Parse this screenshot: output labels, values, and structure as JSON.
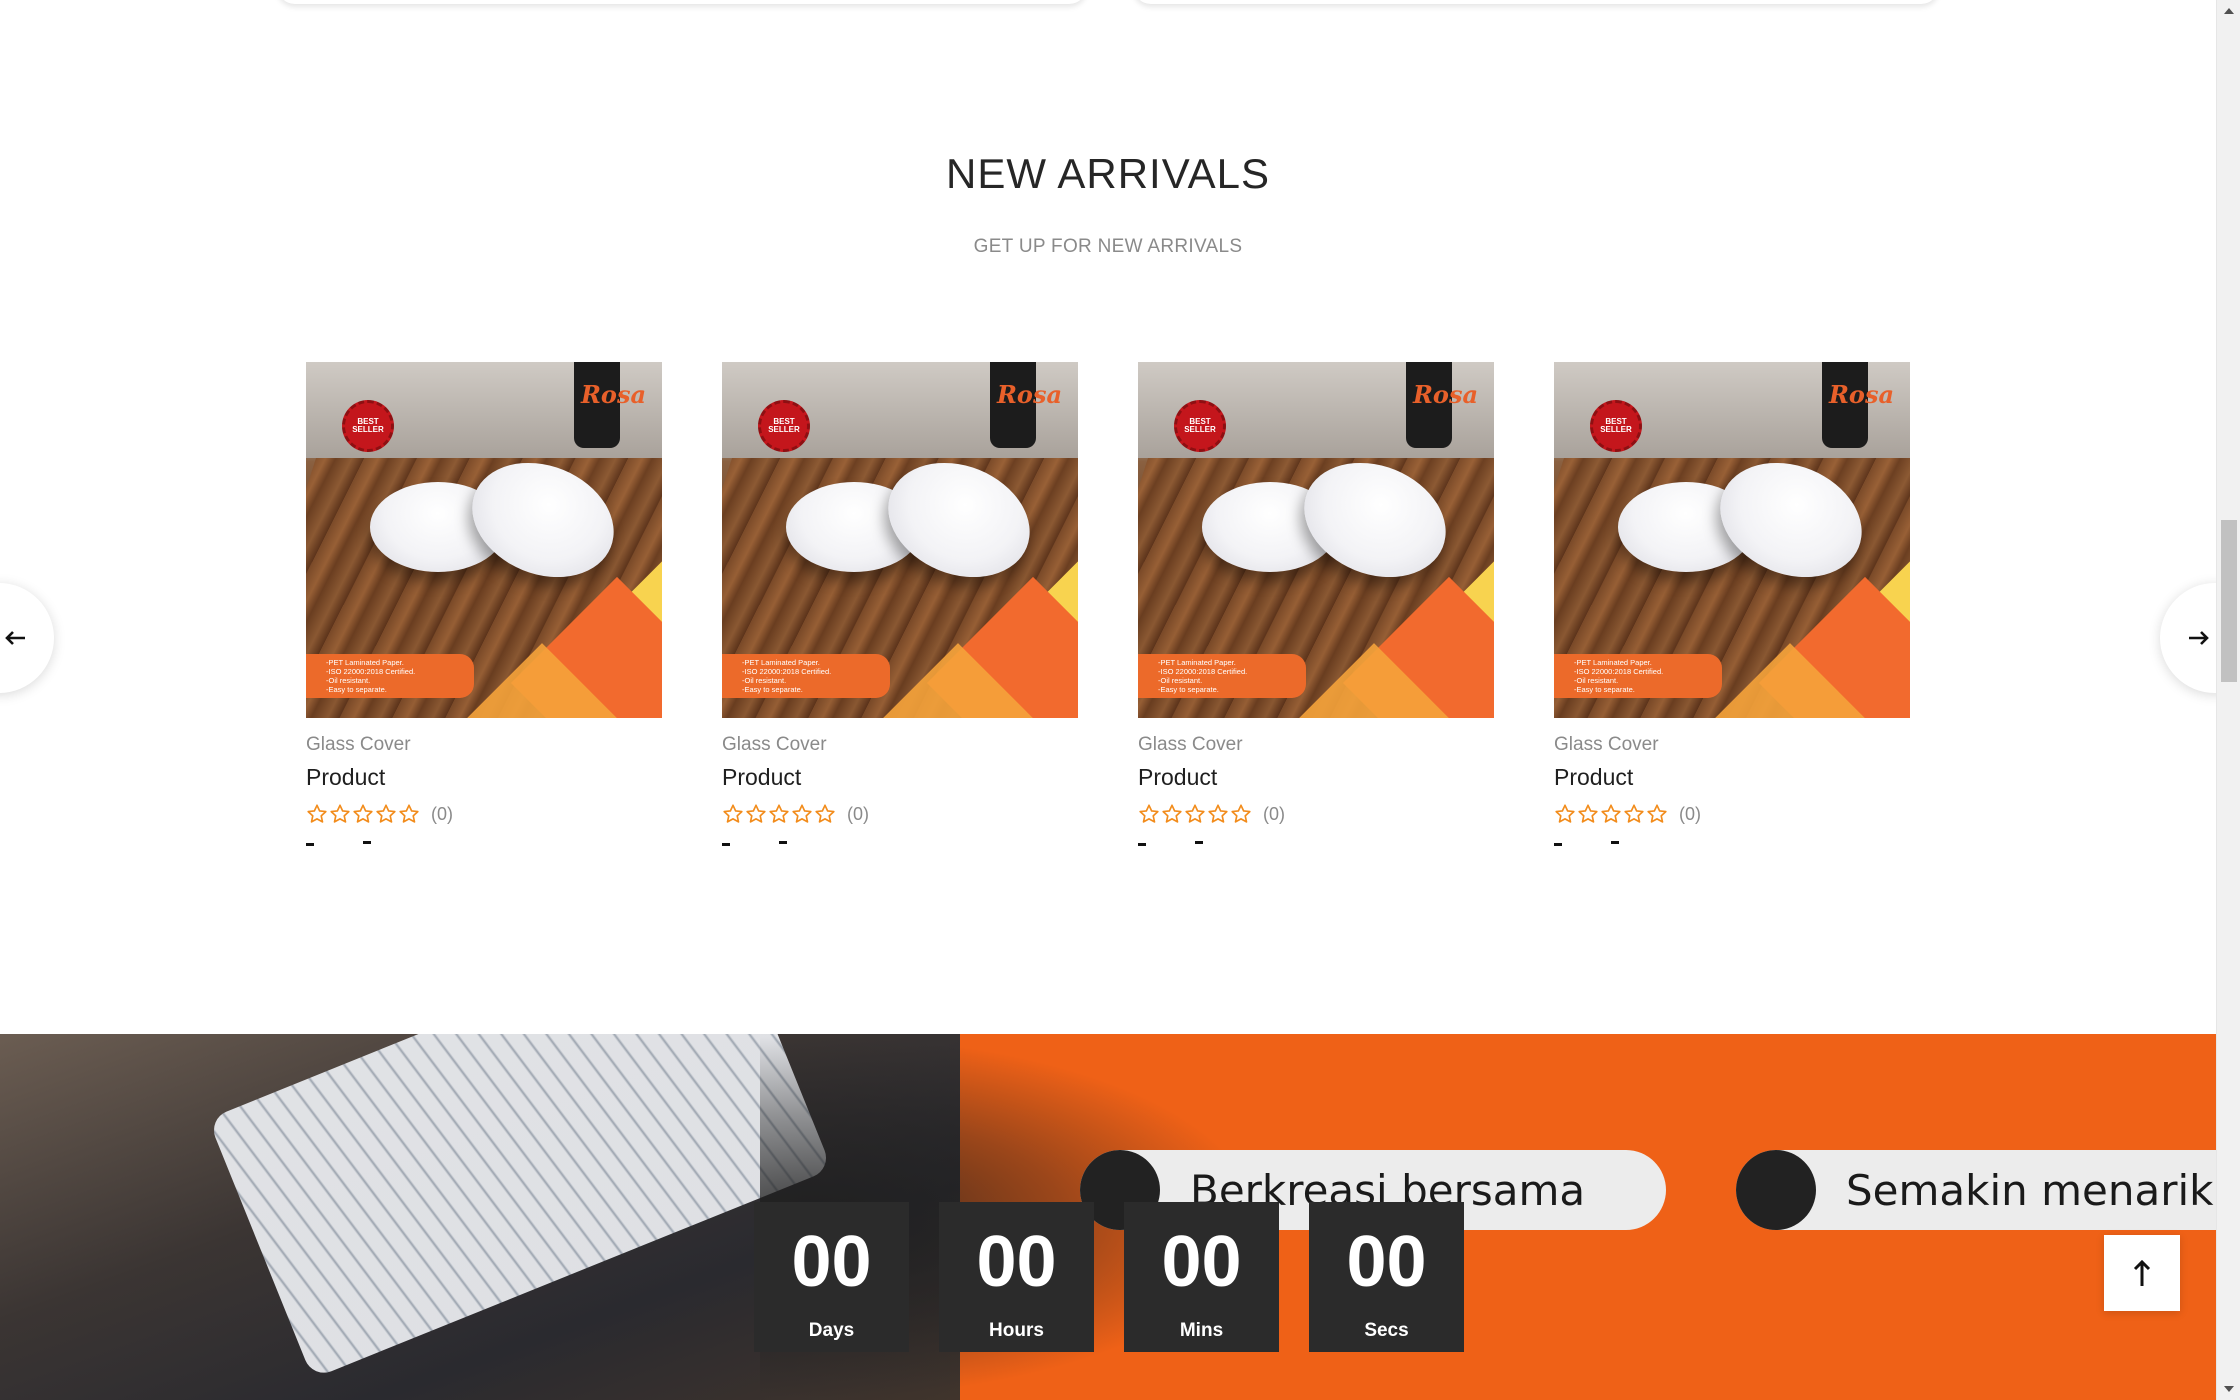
{
  "section": {
    "title": "NEW ARRIVALS",
    "subtitle": "GET UP FOR NEW ARRIVALS"
  },
  "products": [
    {
      "category": "Glass Cover",
      "name": "Product",
      "reviews": "(0)",
      "rating": 0
    },
    {
      "category": "Glass Cover",
      "name": "Product",
      "reviews": "(0)",
      "rating": 0
    },
    {
      "category": "Glass Cover",
      "name": "Product",
      "reviews": "(0)",
      "rating": 0
    },
    {
      "category": "Glass Cover",
      "name": "Product",
      "reviews": "(0)",
      "rating": 0
    }
  ],
  "product_image": {
    "brand": "Rosa",
    "seal": "BEST SELLER",
    "features": [
      "-PET Laminated Paper.",
      "-ISO 22000:2018 Certified.",
      "-Oil resistant.",
      "-Easy to separate."
    ]
  },
  "icons": {
    "prev": "arrow-left-icon",
    "next": "arrow-right-icon",
    "back_to_top": "arrow-up-icon",
    "star": "star-outline-icon"
  },
  "banner": {
    "pill1": "Berkreasi bersama",
    "pill2": "Semakin menarik"
  },
  "countdown": {
    "days": "00",
    "days_label": "Days",
    "hours": "00",
    "hours_label": "Hours",
    "mins": "00",
    "mins_label": "Mins",
    "secs": "00",
    "secs_label": "Secs"
  },
  "colors": {
    "accent": "#ef6117",
    "star": "#f28c1c",
    "countdown_bg": "#2b2b2b"
  }
}
